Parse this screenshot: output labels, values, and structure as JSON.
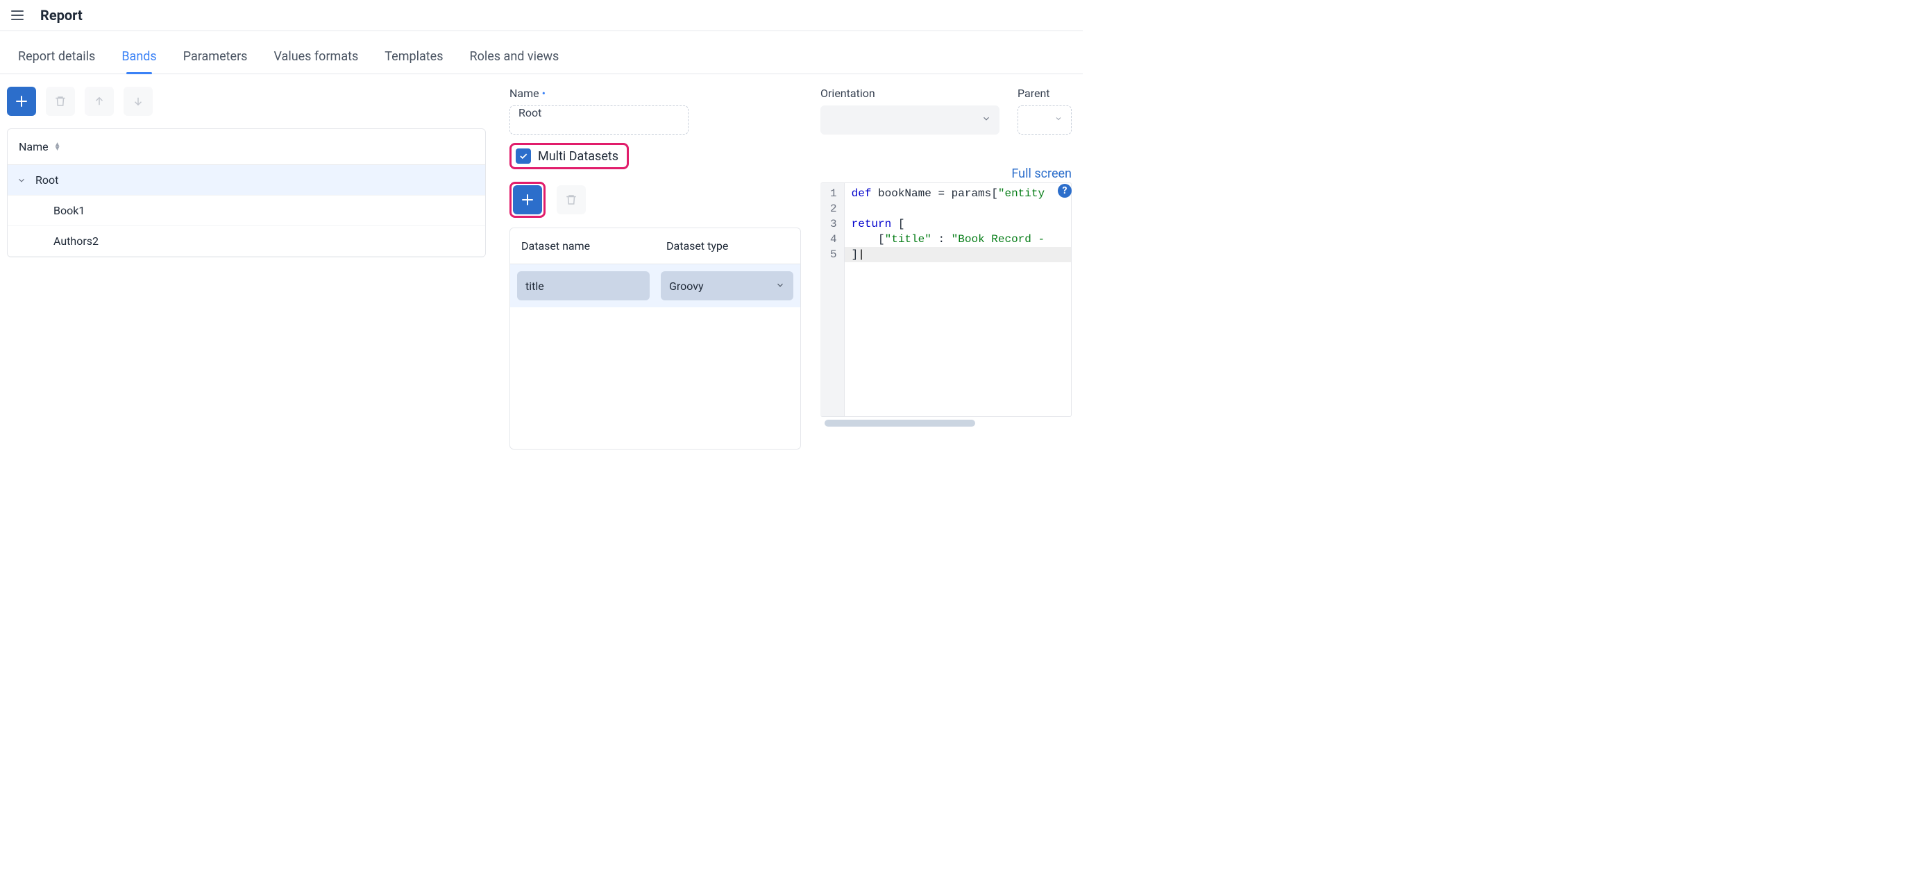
{
  "header": {
    "title": "Report"
  },
  "tabs": [
    {
      "label": "Report details",
      "active": false
    },
    {
      "label": "Bands",
      "active": true
    },
    {
      "label": "Parameters",
      "active": false
    },
    {
      "label": "Values formats",
      "active": false
    },
    {
      "label": "Templates",
      "active": false
    },
    {
      "label": "Roles and views",
      "active": false
    }
  ],
  "band_tree": {
    "column_header": "Name",
    "rows": [
      {
        "label": "Root",
        "depth": 0,
        "expandable": true,
        "selected": true
      },
      {
        "label": "Book1",
        "depth": 1,
        "expandable": false,
        "selected": false
      },
      {
        "label": "Authors2",
        "depth": 1,
        "expandable": false,
        "selected": false
      }
    ]
  },
  "form": {
    "name_label": "Name",
    "name_value": "Root",
    "orientation_label": "Orientation",
    "orientation_value": "",
    "parent_label": "Parent",
    "parent_value": "",
    "multi_datasets_label": "Multi Datasets",
    "multi_datasets_checked": true
  },
  "datasets": {
    "full_screen_label": "Full screen",
    "columns": {
      "name": "Dataset name",
      "type": "Dataset type"
    },
    "rows": [
      {
        "name": "title",
        "type": "Groovy"
      }
    ]
  },
  "code": {
    "lines": [
      {
        "n": 1,
        "tokens": [
          {
            "t": "kw",
            "v": "def"
          },
          {
            "t": "",
            "v": " bookName = params["
          },
          {
            "t": "str",
            "v": "\"entity"
          }
        ]
      },
      {
        "n": 2,
        "tokens": []
      },
      {
        "n": 3,
        "tokens": [
          {
            "t": "kw",
            "v": "return"
          },
          {
            "t": "",
            "v": " ["
          }
        ]
      },
      {
        "n": 4,
        "tokens": [
          {
            "t": "",
            "v": "    ["
          },
          {
            "t": "str",
            "v": "\"title\""
          },
          {
            "t": "",
            "v": " : "
          },
          {
            "t": "str",
            "v": "\"Book Record -"
          }
        ]
      },
      {
        "n": 5,
        "tokens": [
          {
            "t": "",
            "v": "]"
          }
        ],
        "current": true
      }
    ]
  }
}
